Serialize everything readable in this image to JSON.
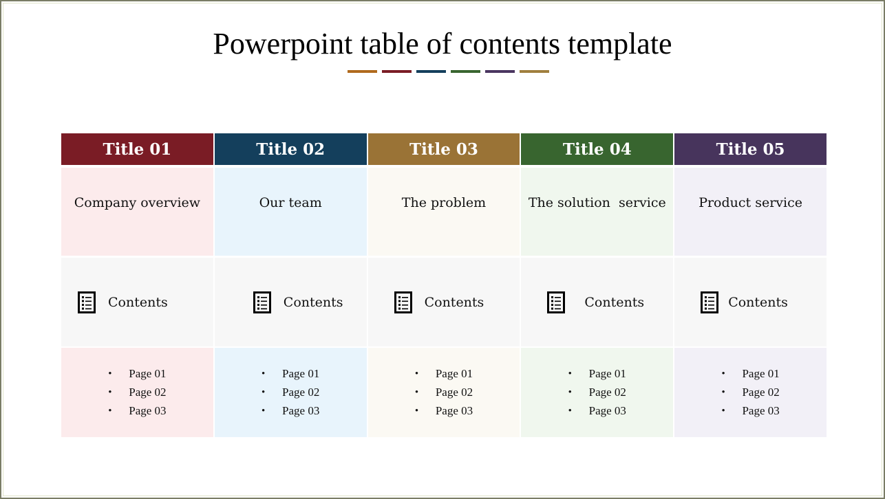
{
  "slide": {
    "title": "Powerpoint table of contents template",
    "underline_colors": [
      "#b06a1d",
      "#7a1c25",
      "#143f5c",
      "#39652f",
      "#4a3560",
      "#a07f3e"
    ]
  },
  "columns": [
    {
      "header": "Title 01",
      "header_color": "#7a1c25",
      "tint_color": "#fcebec",
      "name": "Company overview",
      "contents_label": "Contents",
      "contents_icon": "list-document-icon",
      "pages": [
        "Page 01",
        "Page 02",
        "Page 03"
      ]
    },
    {
      "header": "Title 02",
      "header_color": "#143f5c",
      "tint_color": "#e8f4fc",
      "name": "Our team",
      "contents_label": "Contents",
      "contents_icon": "list-document-icon",
      "pages": [
        "Page 01",
        "Page 02",
        "Page 03"
      ]
    },
    {
      "header": "Title 03",
      "header_color": "#9a7336",
      "tint_color": "#fbf9f3",
      "name": "The problem",
      "contents_label": "Contents",
      "contents_icon": "list-document-icon",
      "pages": [
        "Page 01",
        "Page 02",
        "Page 03"
      ]
    },
    {
      "header": "Title 04",
      "header_color": "#38652f",
      "tint_color": "#f0f7ee",
      "name": "The solution  service",
      "contents_label": "Contents",
      "contents_icon": "list-document-icon",
      "pages": [
        "Page 01",
        "Page 02",
        "Page 03"
      ]
    },
    {
      "header": "Title 05",
      "header_color": "#47345c",
      "tint_color": "#f2f0f7",
      "name": "Product service",
      "contents_label": "Contents",
      "contents_icon": "list-document-icon",
      "pages": [
        "Page 01",
        "Page 02",
        "Page 03"
      ]
    }
  ],
  "bullet_glyph": "•"
}
